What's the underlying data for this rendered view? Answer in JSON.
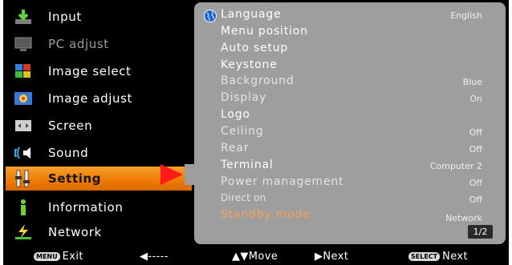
{
  "menu": [
    {
      "label": "Input",
      "icon": "input-icon",
      "state": "normal"
    },
    {
      "label": "PC adjust",
      "icon": "pc-adjust-icon",
      "state": "disabled"
    },
    {
      "label": "Image select",
      "icon": "image-select-icon",
      "state": "normal"
    },
    {
      "label": "Image adjust",
      "icon": "image-adjust-icon",
      "state": "normal"
    },
    {
      "label": "Screen",
      "icon": "screen-icon",
      "state": "normal"
    },
    {
      "label": "Sound",
      "icon": "sound-icon",
      "state": "normal"
    },
    {
      "label": "Setting",
      "icon": "setting-icon",
      "state": "active"
    },
    {
      "label": "Information",
      "icon": "information-icon",
      "state": "normal"
    },
    {
      "label": "Network",
      "icon": "network-icon",
      "state": "normal"
    }
  ],
  "settings": [
    {
      "name": "Language",
      "value": "English"
    },
    {
      "name": "Menu position",
      "value": ""
    },
    {
      "name": "Auto setup",
      "value": ""
    },
    {
      "name": "Keystone",
      "value": ""
    },
    {
      "name": "Background",
      "value": "Blue"
    },
    {
      "name": "Display",
      "value": "On"
    },
    {
      "name": "Logo",
      "value": ""
    },
    {
      "name": "Ceiling",
      "value": "Off"
    },
    {
      "name": "Rear",
      "value": "Off"
    },
    {
      "name": "Terminal",
      "value": "Computer 2"
    },
    {
      "name": "Power management",
      "value": "Off"
    },
    {
      "name": "Direct on",
      "value": "Off"
    },
    {
      "name": "Standby mode",
      "value": "Network"
    }
  ],
  "page_indicator": "1/2",
  "footer": {
    "exit_key": "MENU",
    "exit_label": "Exit",
    "back_arrow": "◀-----",
    "move_label": "▲▼Move",
    "next_arrow_label": "▶Next",
    "select_key": "SELECT",
    "select_label": "Next"
  },
  "colors": {
    "accent": "#ef7a05",
    "pointer": "#ff1a1a",
    "panel": "#9e9e9e",
    "highlight_text": "#f3a25a"
  }
}
